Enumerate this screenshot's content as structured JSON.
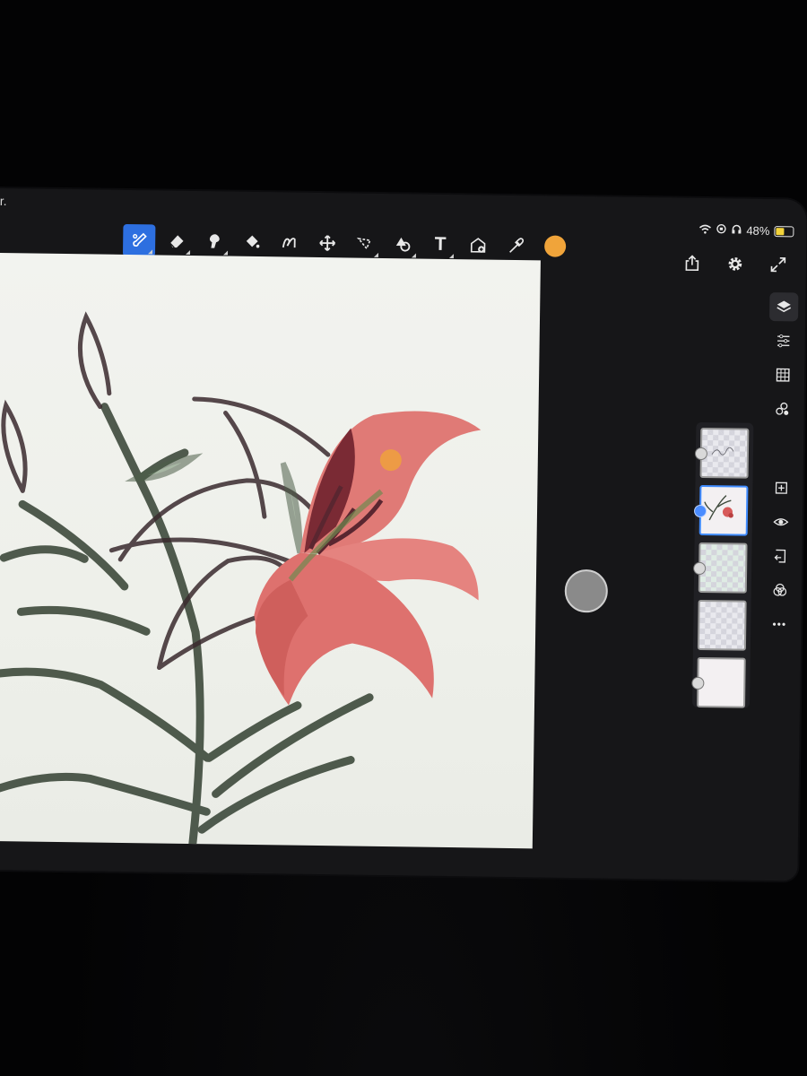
{
  "status_bar": {
    "left_fragment": "r.",
    "battery_text": "48%"
  },
  "colors": {
    "active_tool": "#2d6fe0",
    "current_color": "#f0a43a",
    "selected_layer": "#3f8bff",
    "battery": "#f2d33a"
  },
  "toolbar": {
    "tools": [
      {
        "name": "brush-tool-icon",
        "active": true
      },
      {
        "name": "eraser-tool-icon"
      },
      {
        "name": "smudge-tool-icon"
      },
      {
        "name": "fill-tool-icon"
      },
      {
        "name": "shape-tool-icon"
      },
      {
        "name": "move-tool-icon"
      },
      {
        "name": "lasso-select-icon"
      },
      {
        "name": "shapes-tool-icon"
      },
      {
        "name": "text-tool-icon",
        "glyph": "T"
      },
      {
        "name": "image-import-icon"
      },
      {
        "name": "eyedropper-icon"
      }
    ]
  },
  "top_right": [
    "share-icon",
    "gear-icon",
    "fullscreen-icon"
  ],
  "sidebar": {
    "items": [
      "layers-icon",
      "adjustments-icon",
      "grid-icon",
      "blend-icon",
      "add-layer-icon",
      "visibility-icon",
      "import-icon",
      "filter-icon",
      "more-icon"
    ],
    "more_glyph": "•••"
  },
  "layers": {
    "items": [
      {
        "kind": "sketch-text",
        "selected": false
      },
      {
        "kind": "lily",
        "selected": true
      },
      {
        "kind": "transparent-green",
        "selected": false
      },
      {
        "kind": "transparent",
        "selected": false
      },
      {
        "kind": "background",
        "selected": false
      }
    ]
  }
}
